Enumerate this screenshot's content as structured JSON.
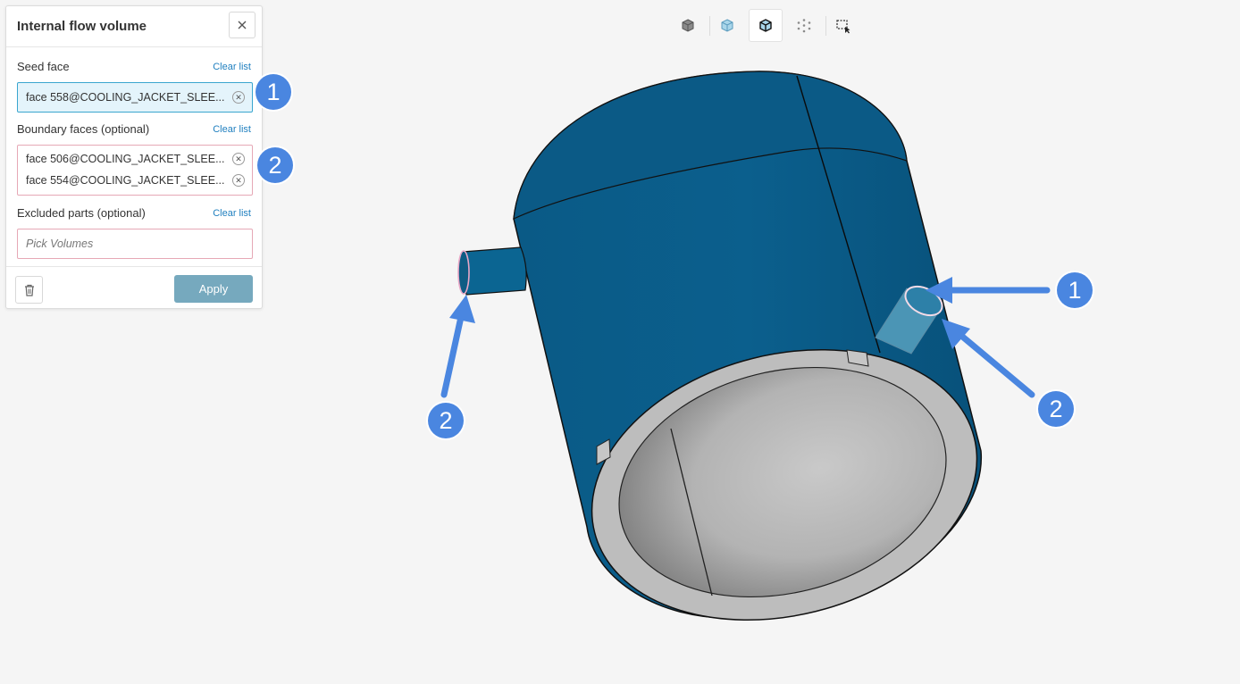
{
  "panel": {
    "title": "Internal flow volume",
    "close_icon": "close-icon",
    "seed": {
      "label": "Seed face",
      "clear": "Clear list",
      "items": [
        "face 558@COOLING_JACKET_SLEE..."
      ]
    },
    "boundary": {
      "label": "Boundary faces (optional)",
      "clear": "Clear list",
      "items": [
        "face 506@COOLING_JACKET_SLEE...",
        "face 554@COOLING_JACKET_SLEE..."
      ]
    },
    "excluded": {
      "label": "Excluded parts (optional)",
      "clear": "Clear list",
      "placeholder": "Pick Volumes"
    },
    "apply": "Apply",
    "trash_icon": "trash-icon"
  },
  "badges": {
    "panel_seed": "1",
    "panel_boundary": "2",
    "viewport_right_1": "1",
    "viewport_right_2": "2",
    "viewport_left_2": "2"
  },
  "toolbar": {
    "icons": [
      "solid-view-icon",
      "transparent-view-icon",
      "wireframe-edges-icon",
      "points-view-icon",
      "box-select-icon"
    ],
    "active": "wireframe-edges-icon"
  },
  "colors": {
    "accent": "#4a86e0",
    "model_blue": "#0b5b86",
    "model_gray": "#b8b8b8",
    "apply_bg": "#76a9be",
    "link": "#1f7fbf"
  }
}
